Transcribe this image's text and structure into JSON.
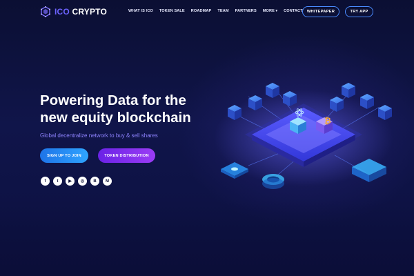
{
  "brand": {
    "name_prefix": "ICO",
    "name_suffix": " CRYPTO",
    "accent": "#6d63ff"
  },
  "nav": {
    "items": [
      "WHAT IS ICO",
      "TOKEN SALE",
      "ROADMAP",
      "TEAM",
      "PARTNERS",
      "MORE",
      "CONTACT"
    ]
  },
  "header_buttons": {
    "whitepaper": "WHITEPAPER",
    "try_app": "TRY APP"
  },
  "hero": {
    "title_line1": "Powering Data for the",
    "title_line2": "new equity blockchain",
    "subtitle": "Global decentralize network to buy & sell shares",
    "cta_primary": "SIGN UP TO JOIN",
    "cta_secondary": "TOKEN DISTRIBUTION"
  },
  "social": [
    {
      "icon": "facebook-icon",
      "glyph": "f"
    },
    {
      "icon": "twitter-icon",
      "glyph": "t"
    },
    {
      "icon": "youtube-icon",
      "glyph": "▶"
    },
    {
      "icon": "github-icon",
      "glyph": "◎"
    },
    {
      "icon": "bitcoin-icon",
      "glyph": "B"
    },
    {
      "icon": "medium-icon",
      "glyph": "M"
    }
  ],
  "colors": {
    "background": "#0d1137",
    "primary_button": "#2a8cf5",
    "secondary_button": "#8a32f0",
    "outline": "#4a8bff"
  }
}
